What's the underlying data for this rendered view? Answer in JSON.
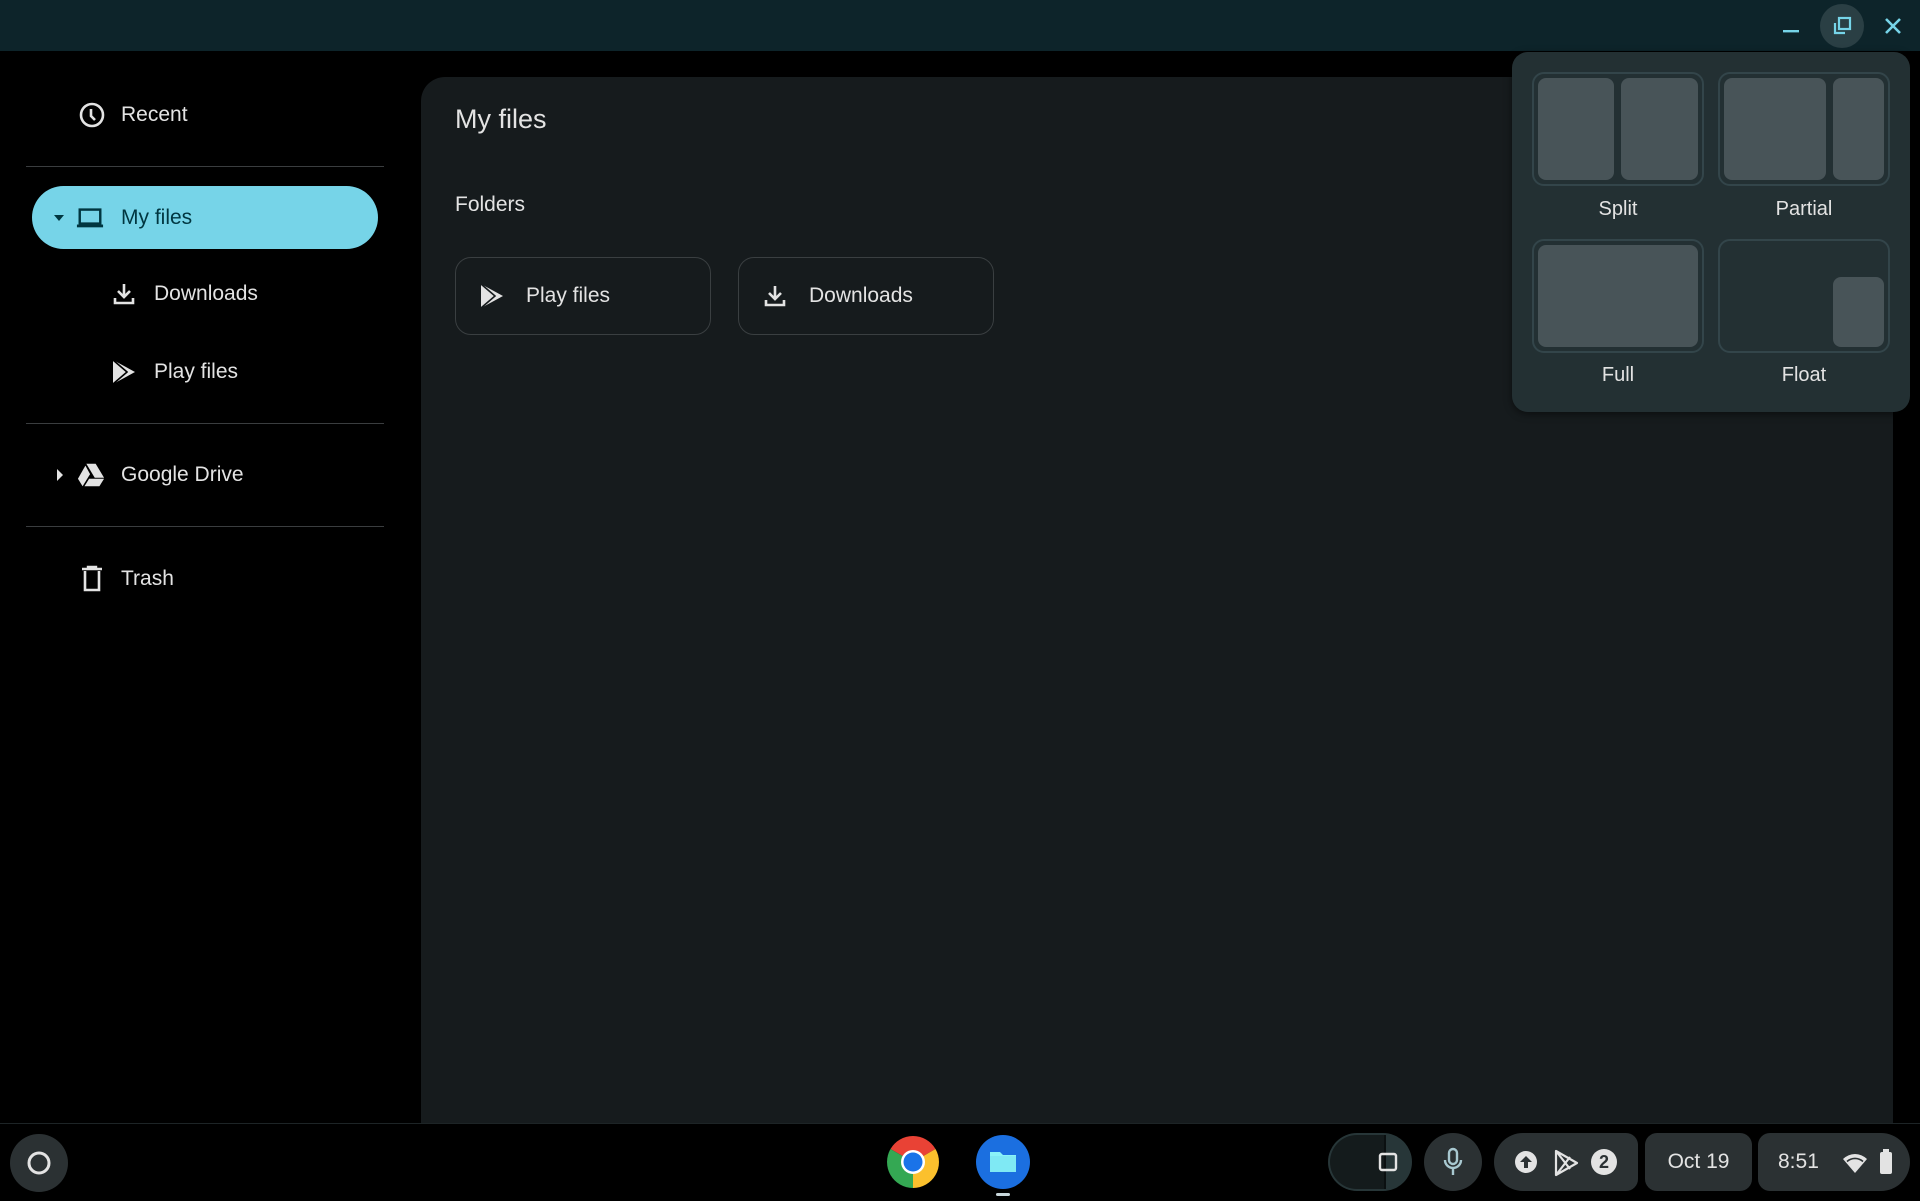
{
  "window": {
    "controls": {
      "minimize_icon": "minimize-icon",
      "restore_icon": "restore-icon",
      "close_icon": "close-icon"
    },
    "accent_color": "#76d4e8"
  },
  "sidebar": {
    "items": [
      {
        "label": "Recent",
        "icon": "clock-icon"
      },
      {
        "label": "My files",
        "icon": "laptop-icon",
        "selected": true,
        "expanded": true
      },
      {
        "label": "Downloads",
        "icon": "download-icon"
      },
      {
        "label": "Play files",
        "icon": "play-store-icon"
      },
      {
        "label": "Google Drive",
        "icon": "google-drive-icon",
        "expanded": false
      },
      {
        "label": "Trash",
        "icon": "trash-icon"
      }
    ]
  },
  "main": {
    "title": "My files",
    "section_title": "Folders",
    "folders": [
      {
        "label": "Play files",
        "icon": "play-store-icon"
      },
      {
        "label": "Downloads",
        "icon": "download-icon"
      }
    ]
  },
  "snap_menu": {
    "options": [
      {
        "label": "Split"
      },
      {
        "label": "Partial"
      },
      {
        "label": "Full"
      },
      {
        "label": "Float"
      }
    ]
  },
  "shelf": {
    "apps": [
      {
        "name": "Chrome",
        "icon": "chrome-icon"
      },
      {
        "name": "Files",
        "icon": "files-icon",
        "running": true
      }
    ],
    "tray": {
      "notification_count": "2",
      "date": "Oct 19",
      "time": "8:51"
    }
  }
}
